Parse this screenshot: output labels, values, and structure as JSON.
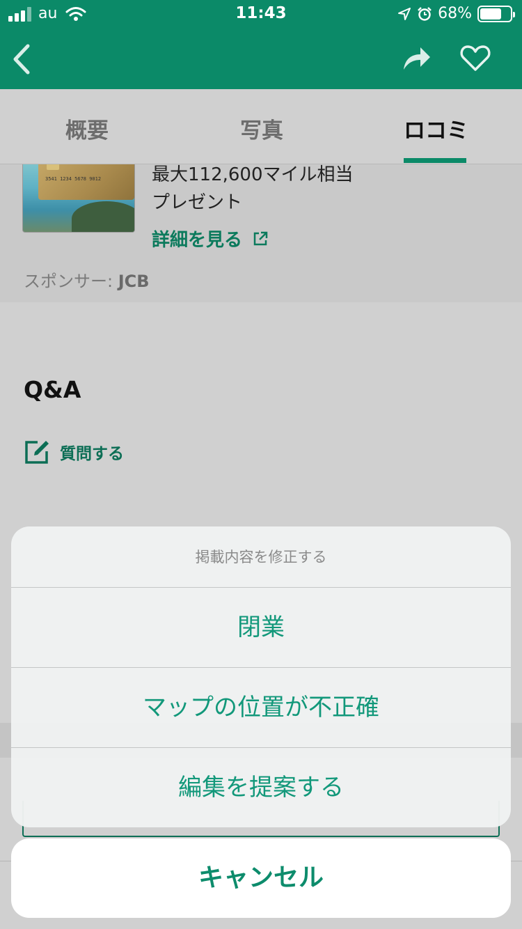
{
  "status_bar": {
    "carrier": "au",
    "time": "11:43",
    "battery": "68%"
  },
  "nav": {
    "back_icon": "chevron-left-icon",
    "share_icon": "share-arrow-icon",
    "favorite_icon": "heart-icon"
  },
  "tabs": [
    {
      "label": "概要"
    },
    {
      "label": "写真"
    },
    {
      "label": "ロコミ",
      "active": true
    }
  ],
  "ad": {
    "headline": "最大112,600マイル相当",
    "subline": "プレゼント",
    "link_label": "詳細を見る",
    "sponsor_prefix": "スポンサー: ",
    "sponsor_name": "JCB",
    "card_number": "3541 1234 5678 9012"
  },
  "qa": {
    "title": "Q&A",
    "ask_label": "質問する"
  },
  "action_sheet": {
    "title": "掲載内容を修正する",
    "options": [
      "閉業",
      "マップの位置が不正確",
      "編集を提案する"
    ],
    "cancel": "キャンセル"
  },
  "colors": {
    "brand": "#0b8a68",
    "action": "#12987a"
  }
}
